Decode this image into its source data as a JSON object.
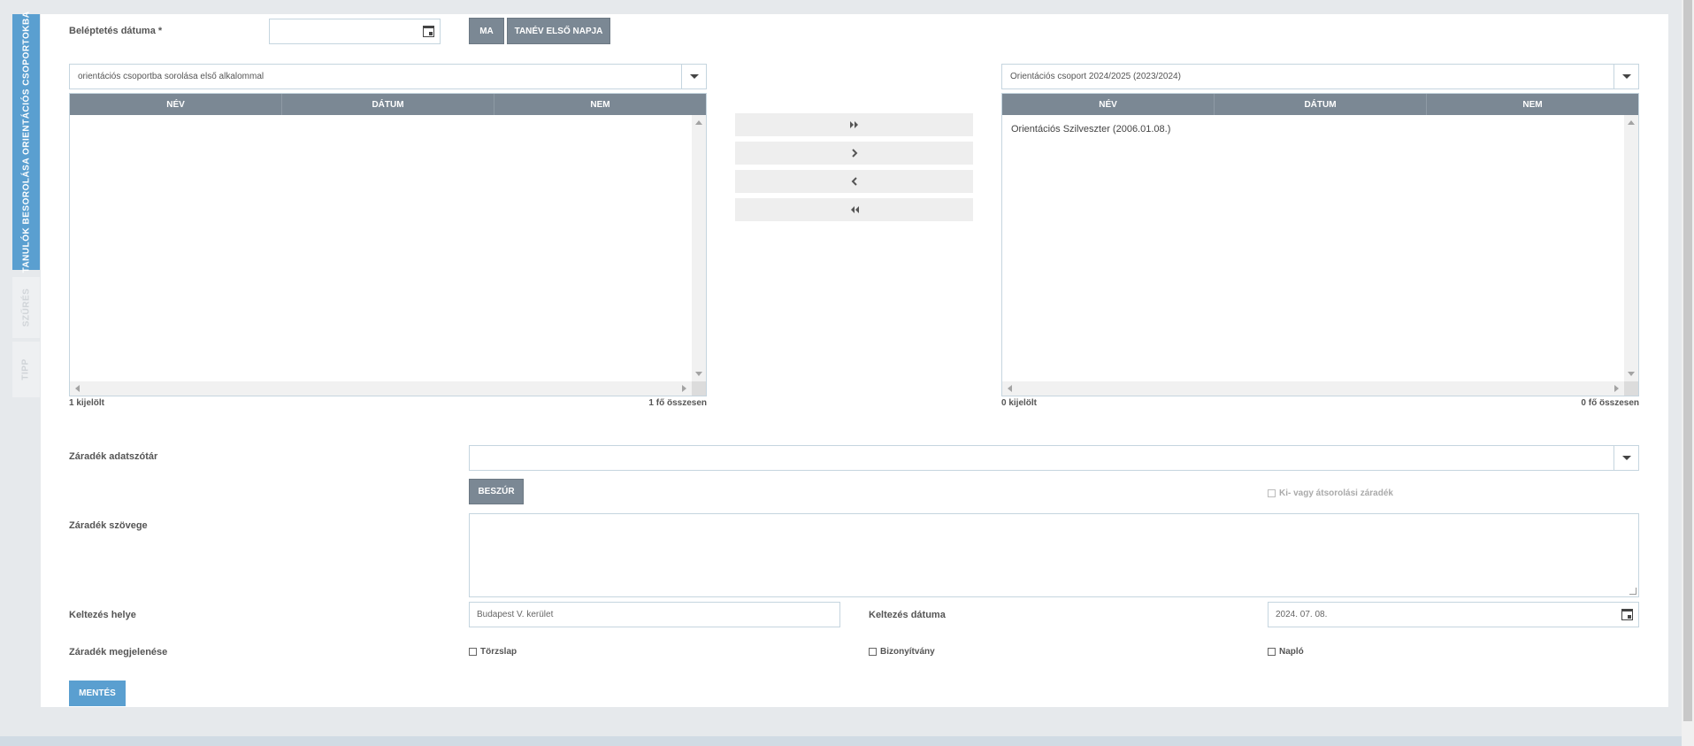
{
  "side_tabs": {
    "main": "TANULÓK BESOROLÁSA ORIENTÁCIÓS CSOPORTOKBA",
    "filter": "SZŰRÉS",
    "tip": "TIPP"
  },
  "entry_date": {
    "label": "Beléptetés dátuma *",
    "value": "",
    "btn_today": "MA",
    "btn_first_day": "TANÉV ELSŐ NAPJA"
  },
  "left_list": {
    "select_value": "orientációs csoportba sorolása első alkalommal",
    "columns": [
      "NÉV",
      "DÁTUM",
      "NEM"
    ],
    "rows": [],
    "selected_count": "1 kijelölt",
    "total_count": "1 fő összesen"
  },
  "move_buttons": {
    "all_right": "⯮⯮",
    "one_right": "›",
    "one_left": "‹",
    "all_left": "⯬⯬"
  },
  "right_list": {
    "select_value": "Orientációs csoport 2024/2025 (2023/2024)",
    "columns": [
      "NÉV",
      "DÁTUM",
      "NEM"
    ],
    "rows": [
      "Orientációs Szilveszter (2006.01.08.)"
    ],
    "selected_count": "0 kijelölt",
    "total_count": "0 fő összesen"
  },
  "clause": {
    "dictionary_label": "Záradék adatszótár",
    "dictionary_value": "",
    "insert_btn": "BESZÚR",
    "transfer_checkbox": "Ki- vagy átsorolási záradék",
    "text_label": "Záradék szövege",
    "text_value": ""
  },
  "dating": {
    "place_label": "Keltezés helye",
    "place_value": "Budapest V. kerület",
    "date_label": "Keltezés dátuma",
    "date_value": "2024. 07. 08."
  },
  "appearance": {
    "label": "Záradék megjelenése",
    "options": [
      "Törzslap",
      "Bizonyítvány",
      "Napló"
    ]
  },
  "save_btn": "MENTÉS"
}
